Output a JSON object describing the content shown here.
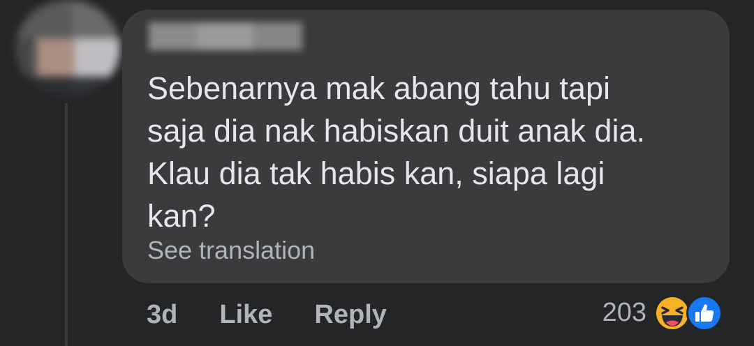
{
  "comment": {
    "lines": [
      "Sebenarnya mak abang tahu tapi",
      "saja dia nak habiskan duit anak dia.",
      "Klau dia tak habis kan, siapa lagi",
      "kan?"
    ],
    "see_translation_label": "See translation"
  },
  "actions": {
    "time": "3d",
    "like_label": "Like",
    "reply_label": "Reply"
  },
  "reactions": {
    "count": "203",
    "icons": [
      "haha-icon",
      "like-icon"
    ]
  },
  "colors": {
    "background": "#242526",
    "bubble": "#3a3b3c",
    "text": "#e4e6eb",
    "secondary": "#b0b3b8",
    "like_blue": "#1877f2",
    "haha_yellow": "#f7b125"
  }
}
